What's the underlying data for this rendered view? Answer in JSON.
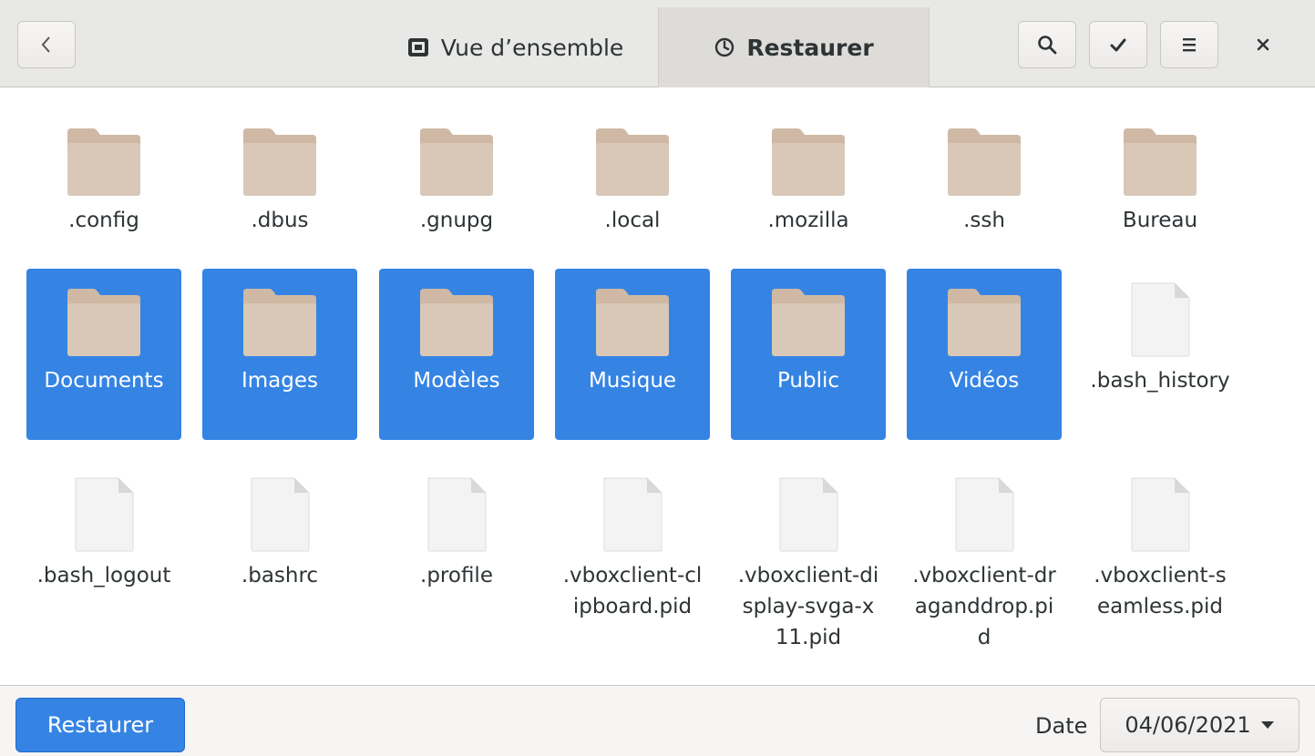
{
  "header": {
    "tabs": [
      {
        "label": "Vue d’ensemble",
        "icon": "overview-icon"
      },
      {
        "label": "Restaurer",
        "icon": "clock-icon",
        "active": true
      }
    ],
    "buttons": {
      "back": "chevron-left-icon",
      "search": "search-icon",
      "select": "checkmark-icon",
      "menu": "hamburger-menu-icon",
      "close": "close-icon"
    }
  },
  "files": [
    {
      "name": ".config",
      "type": "folder",
      "selected": false
    },
    {
      "name": ".dbus",
      "type": "folder",
      "selected": false
    },
    {
      "name": ".gnupg",
      "type": "folder",
      "selected": false
    },
    {
      "name": ".local",
      "type": "folder",
      "selected": false
    },
    {
      "name": ".mozilla",
      "type": "folder",
      "selected": false
    },
    {
      "name": ".ssh",
      "type": "folder",
      "selected": false
    },
    {
      "name": "Bureau",
      "type": "folder",
      "selected": false
    },
    {
      "name": "Documents",
      "type": "folder",
      "selected": true
    },
    {
      "name": "Images",
      "type": "folder",
      "selected": true
    },
    {
      "name": "Modèles",
      "type": "folder",
      "selected": true
    },
    {
      "name": "Musique",
      "type": "folder",
      "selected": true
    },
    {
      "name": "Public",
      "type": "folder",
      "selected": true
    },
    {
      "name": "Vidéos",
      "type": "folder",
      "selected": true
    },
    {
      "name": ".bash_history",
      "type": "file",
      "selected": false
    },
    {
      "name": ".bash_logout",
      "type": "file",
      "selected": false
    },
    {
      "name": ".bashrc",
      "type": "file",
      "selected": false
    },
    {
      "name": ".profile",
      "type": "file",
      "selected": false
    },
    {
      "name": ".vboxclient-clipboard.pid",
      "type": "file",
      "selected": false
    },
    {
      "name": ".vboxclient-display-svga-x11.pid",
      "type": "file",
      "selected": false
    },
    {
      "name": ".vboxclient-draganddrop.pid",
      "type": "file",
      "selected": false
    },
    {
      "name": ".vboxclient-seamless.pid",
      "type": "file",
      "selected": false
    }
  ],
  "footer": {
    "restore_label": "Restaurer",
    "date_label": "Date",
    "date_value": "04/06/2021"
  },
  "colors": {
    "selection": "#3584e4",
    "folder": "#d9c8b8",
    "folder_tab": "#cfb9a4",
    "file": "#f3f3f3"
  }
}
